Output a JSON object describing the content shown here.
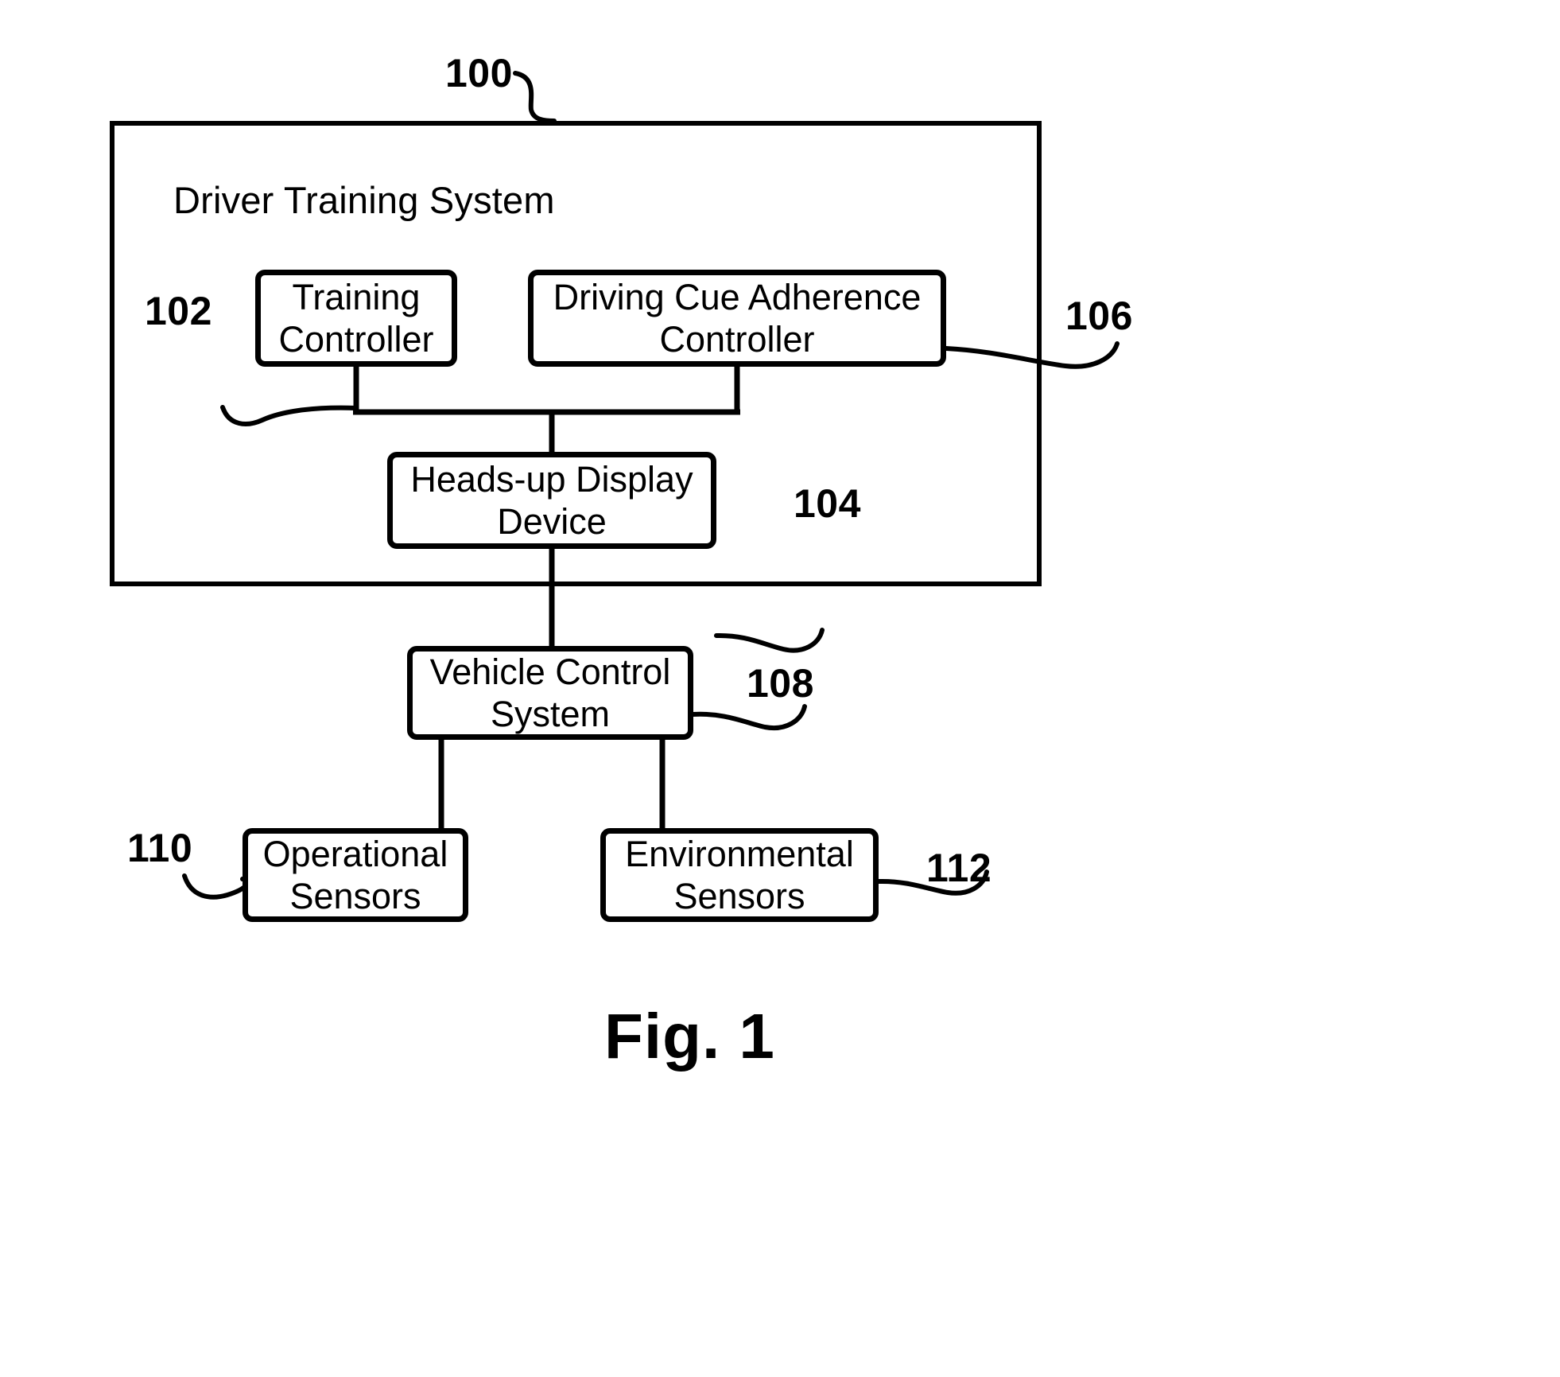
{
  "figure": {
    "caption": "Fig. 1",
    "system_frame": {
      "title": "Driver Training System",
      "ref": "100"
    }
  },
  "nodes": [
    {
      "id": "training-controller",
      "label": "Training\nController",
      "ref": "102"
    },
    {
      "id": "driving-cue-adherence-controller",
      "label": "Driving Cue Adherence\nController",
      "ref": "106"
    },
    {
      "id": "heads-up-display-device",
      "label": "Heads-up Display\nDevice",
      "ref": "104"
    },
    {
      "id": "vehicle-control-system",
      "label": "Vehicle Control\nSystem",
      "ref": "108"
    },
    {
      "id": "operational-sensors",
      "label": "Operational\nSensors",
      "ref": "110"
    },
    {
      "id": "environmental-sensors",
      "label": "Environmental\nSensors",
      "ref": "112"
    }
  ],
  "refs": {
    "r100": "100",
    "r102": "102",
    "r104": "104",
    "r106": "106",
    "r108": "108",
    "r110": "110",
    "r112": "112"
  },
  "colors": {
    "stroke": "#000000",
    "background": "#ffffff"
  },
  "connections": [
    {
      "from": "training-controller",
      "to": "heads-up-display-device"
    },
    {
      "from": "driving-cue-adherence-controller",
      "to": "heads-up-display-device"
    },
    {
      "from": "heads-up-display-device",
      "to": "vehicle-control-system"
    },
    {
      "from": "vehicle-control-system",
      "to": "operational-sensors"
    },
    {
      "from": "vehicle-control-system",
      "to": "environmental-sensors"
    }
  ]
}
